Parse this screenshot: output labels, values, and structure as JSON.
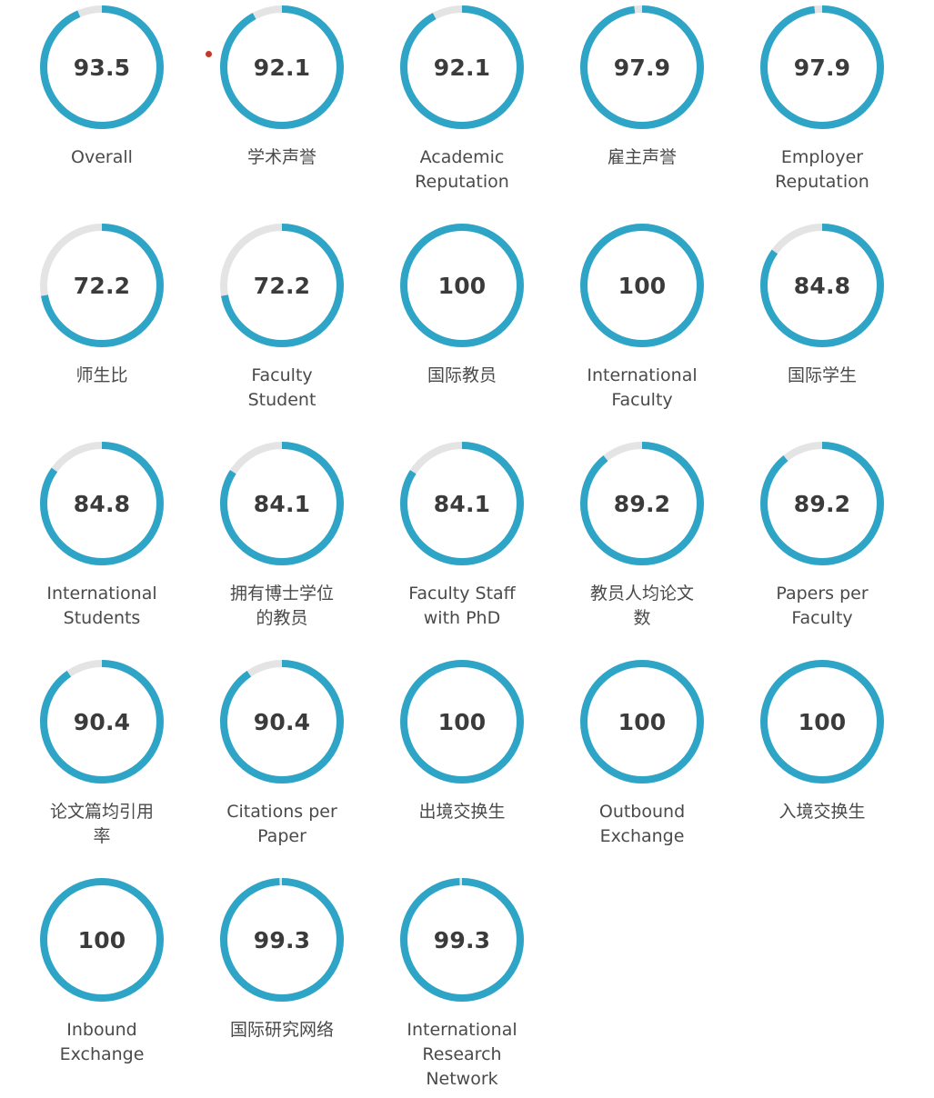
{
  "colors": {
    "arc": "#2ea4c6",
    "track": "#e4e4e4",
    "value_text": "#3b3b3b",
    "label_text": "#4a4a4a",
    "marker_dot": "#c0392b",
    "background": "#ffffff"
  },
  "chart_data": {
    "type": "pie",
    "title": "",
    "subtitle": "",
    "xlabel": "",
    "ylabel": "",
    "grid": false,
    "legend": "none",
    "scale_max": 100,
    "notes": "Grid of 23 donut gauge charts; each gauge arc is drawn clockwise from 12 o'clock, remainder shown as light-grey track. Values are QS-style indicator scores out of 100.",
    "categories": [
      "Overall",
      "学术声誉",
      "Academic Reputation",
      "雇主声誉",
      "Employer Reputation",
      "师生比",
      "Faculty Student",
      "国际教员",
      "International Faculty",
      "国际学生",
      "International Students",
      "拥有博士学位的教员",
      "Faculty Staff with PhD",
      "教员人均论文数",
      "Papers per Faculty",
      "论文篇均引用率",
      "Citations per Paper",
      "出境交换生",
      "Outbound Exchange",
      "入境交换生",
      "Inbound Exchange",
      "国际研究网络",
      "International Research Network"
    ],
    "values": [
      93.5,
      92.1,
      92.1,
      97.9,
      97.9,
      72.2,
      72.2,
      100,
      100,
      84.8,
      84.8,
      84.1,
      84.1,
      89.2,
      89.2,
      90.4,
      90.4,
      100,
      100,
      100,
      100,
      99.3,
      99.3
    ]
  },
  "gauges": [
    {
      "value": "93.5",
      "pct": 93.5,
      "label": "Overall",
      "marker": false
    },
    {
      "value": "92.1",
      "pct": 92.1,
      "label": "学术声誉",
      "marker": true
    },
    {
      "value": "92.1",
      "pct": 92.1,
      "label": "Academic\nReputation",
      "marker": false
    },
    {
      "value": "97.9",
      "pct": 97.9,
      "label": "雇主声誉",
      "marker": false
    },
    {
      "value": "97.9",
      "pct": 97.9,
      "label": "Employer\nReputation",
      "marker": false
    },
    {
      "value": "72.2",
      "pct": 72.2,
      "label": "师生比",
      "marker": false
    },
    {
      "value": "72.2",
      "pct": 72.2,
      "label": "Faculty\nStudent",
      "marker": false
    },
    {
      "value": "100",
      "pct": 100,
      "label": "国际教员",
      "marker": false
    },
    {
      "value": "100",
      "pct": 100,
      "label": "International\nFaculty",
      "marker": false
    },
    {
      "value": "84.8",
      "pct": 84.8,
      "label": "国际学生",
      "marker": false
    },
    {
      "value": "84.8",
      "pct": 84.8,
      "label": "International\nStudents",
      "marker": false
    },
    {
      "value": "84.1",
      "pct": 84.1,
      "label": "拥有博士学位\n的教员",
      "marker": false
    },
    {
      "value": "84.1",
      "pct": 84.1,
      "label": "Faculty Staff\nwith PhD",
      "marker": false
    },
    {
      "value": "89.2",
      "pct": 89.2,
      "label": "教员人均论文\n数",
      "marker": false
    },
    {
      "value": "89.2",
      "pct": 89.2,
      "label": "Papers per\nFaculty",
      "marker": false
    },
    {
      "value": "90.4",
      "pct": 90.4,
      "label": "论文篇均引用\n率",
      "marker": false
    },
    {
      "value": "90.4",
      "pct": 90.4,
      "label": "Citations per\nPaper",
      "marker": false
    },
    {
      "value": "100",
      "pct": 100,
      "label": "出境交换生",
      "marker": false
    },
    {
      "value": "100",
      "pct": 100,
      "label": "Outbound\nExchange",
      "marker": false
    },
    {
      "value": "100",
      "pct": 100,
      "label": "入境交换生",
      "marker": false
    },
    {
      "value": "100",
      "pct": 100,
      "label": "Inbound\nExchange",
      "marker": false
    },
    {
      "value": "99.3",
      "pct": 99.3,
      "label": "国际研究网络",
      "marker": false
    },
    {
      "value": "99.3",
      "pct": 99.3,
      "label": "International\nResearch\nNetwork",
      "marker": false
    }
  ]
}
